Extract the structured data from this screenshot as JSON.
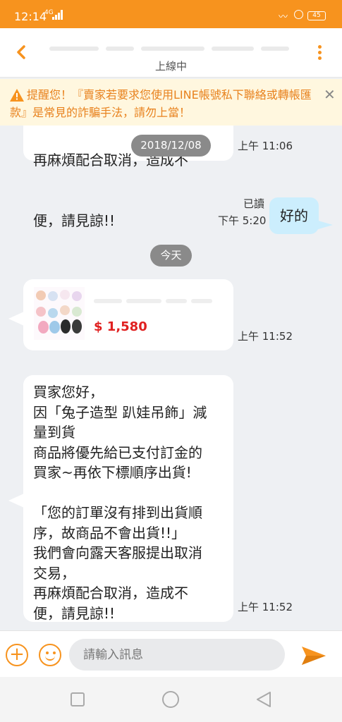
{
  "status_bar": {
    "time": "12:14",
    "network": "4G",
    "battery": "45"
  },
  "header": {
    "status": "上線中"
  },
  "warning": {
    "text": "提醒您！『賣家若要求您使用LINE帳號私下聯絡或轉帳匯款』是常見的詐騙手法，請勿上當！"
  },
  "messages": {
    "partial": {
      "line1": "再麻煩配合取消，造成不",
      "line2": "便，請見諒!!",
      "time": "上午 11:06"
    },
    "date_old": "2018/12/08",
    "mine": {
      "read": "已讀",
      "time": "下午 5:20",
      "text": "好的"
    },
    "date_today": "今天",
    "product": {
      "price": "$ 1,580",
      "time": "上午 11:52"
    },
    "long": {
      "lines": [
        "買家您好，",
        "因「兔子造型 趴娃吊飾」減",
        "量到貨",
        "商品將優先給已支付訂金的",
        "買家~再依下標順序出貨!",
        "",
        "「您的訂單沒有排到出貨順",
        "序，故商品不會出貨!!」",
        "我們會向露天客服提出取消",
        "交易，",
        "再麻煩配合取消，造成不",
        "便，請見諒!!"
      ],
      "time": "上午 11:52"
    }
  },
  "input": {
    "placeholder": "請輸入訊息"
  },
  "colors": {
    "accent": "#f7931e",
    "warning_bg": "#fff7df",
    "my_bubble": "#cceefd",
    "price": "#e02020"
  },
  "icons": {
    "back": "chevron-left-icon",
    "more": "more-vertical-icon",
    "warning": "warning-triangle-icon",
    "close": "close-icon",
    "add": "plus-circle-icon",
    "emoji": "smiley-icon",
    "send": "paper-plane-icon"
  }
}
